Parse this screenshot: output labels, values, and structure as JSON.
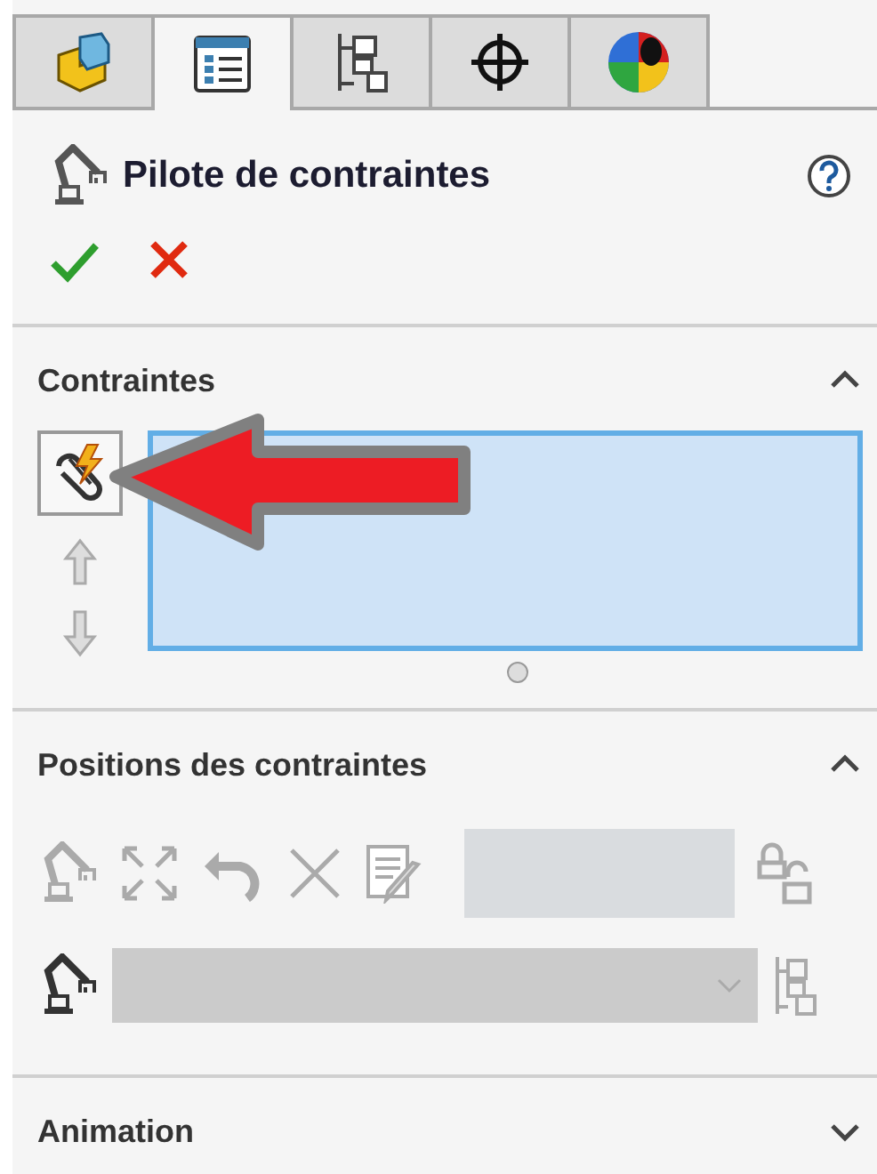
{
  "tabs": [
    {
      "kind": "part",
      "selected": false
    },
    {
      "kind": "property",
      "selected": true
    },
    {
      "kind": "config",
      "selected": false
    },
    {
      "kind": "crosshair",
      "selected": false
    },
    {
      "kind": "appearance",
      "selected": false
    }
  ],
  "title": "Pilote de contraintes",
  "sections": [
    {
      "kind": "constraints",
      "title": "Contraintes",
      "expanded": true
    },
    {
      "kind": "positions",
      "title": "Positions des contraintes",
      "expanded": true,
      "disabled": true
    },
    {
      "kind": "animation",
      "title": "Animation",
      "expanded": false
    }
  ]
}
